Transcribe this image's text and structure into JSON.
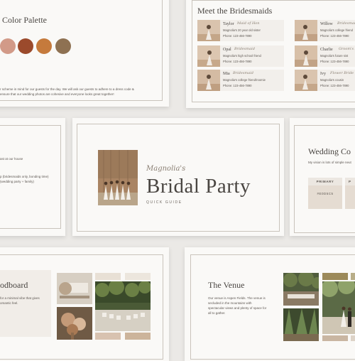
{
  "colors": {
    "background": "#ebe9e6",
    "card": "#faf9f7",
    "frame": "#c9c3bb",
    "text": "#4a4642",
    "swatches": [
      "#d29a88",
      "#9b4a2c",
      "#c57a3c",
      "#8e7152"
    ],
    "chip": "#e5dcd2"
  },
  "palette": {
    "title": "Color Palette",
    "body_line1": "r scheme in mind for our guests for the day. We will ask our guests to adhere to a dress code &",
    "body_line2": "ensure that our wedding photos are cohesive and everyone looks great together!"
  },
  "bridesmaids": {
    "title": "Meet the Bridesmaids",
    "items": [
      {
        "name": "Taylor",
        "role": "Maid of Hon",
        "line1": "Magnolia's 20 year old sister",
        "line2": "Phone: 123-456-7890"
      },
      {
        "name": "Willow",
        "role": "Bridesmaid",
        "line1": "Magnolia's college friend",
        "line2": "Phone: 123-456-7890"
      },
      {
        "name": "Opal",
        "role": "Bridesmaid",
        "line1": "Magnolia's high school friend",
        "line2": "Phone: 123-456-7890"
      },
      {
        "name": "Charlie",
        "role": "Groom's Bridesm",
        "line1": "Magnolia's future sist",
        "line2": "Phone: 123-456-7890"
      },
      {
        "name": "Mia",
        "role": "Bridesmaid",
        "line1": "Magnolia's college friend/roomie",
        "line2": "Phone: 123-456-7890"
      },
      {
        "name": "Ivy",
        "role": "Flower Bride",
        "line1": "Magnolia's cousin",
        "line2": "Phone: 123-456-7890"
      }
    ]
  },
  "schedule": {
    "line1": "ast at our house",
    "line2": "p (bridesmaids only, bonding time)",
    "line3": "(wedding party + family)"
  },
  "cover": {
    "script": "Magnolia's",
    "title": "Bridal Party",
    "subtitle": "QUICK GUIDE"
  },
  "wedding_colors": {
    "title": "Wedding Co",
    "intro": "My vision is lots of simple neut",
    "chips": [
      {
        "label": "PRIMARY",
        "hex": "#E0D5C5"
      },
      {
        "label": "P",
        "hex": ""
      }
    ]
  },
  "moodboard": {
    "title": "odboard",
    "line1": "for a minimal vibe that gives",
    "line2": "omantic feel."
  },
  "venue": {
    "title": "The Venue",
    "line1": "Our venue is Aspen Fields. The venue is",
    "line2": "secluded in the mountains with",
    "line3": "spectacular views and plenty of space for",
    "line4": "all to gather."
  }
}
